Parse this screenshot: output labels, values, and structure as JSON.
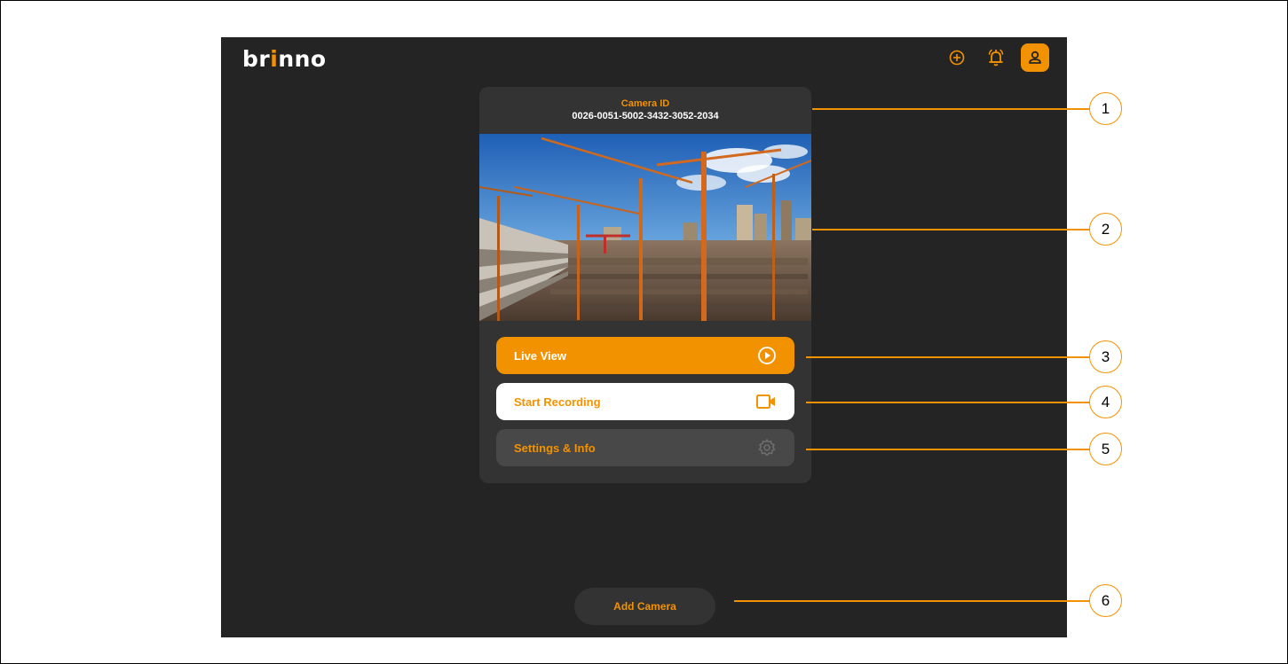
{
  "app": {
    "logo_part1": "br",
    "logo_part2": "i",
    "logo_part3": "nno"
  },
  "topbar": {
    "icons": [
      "add-circle-icon",
      "bell-icon",
      "user-icon"
    ]
  },
  "camera": {
    "id_label": "Camera ID",
    "id_value": "0026-0051-5002-3432-3052-2034",
    "preview": "construction-site-cranes"
  },
  "actions": {
    "live_view": "Live View",
    "start_recording": "Start Recording",
    "settings_info": "Settings & Info"
  },
  "add_camera": "Add Camera",
  "callouts": [
    "1",
    "2",
    "3",
    "4",
    "5",
    "6"
  ],
  "colors": {
    "accent": "#f39200",
    "background": "#242424",
    "card": "#333333"
  }
}
